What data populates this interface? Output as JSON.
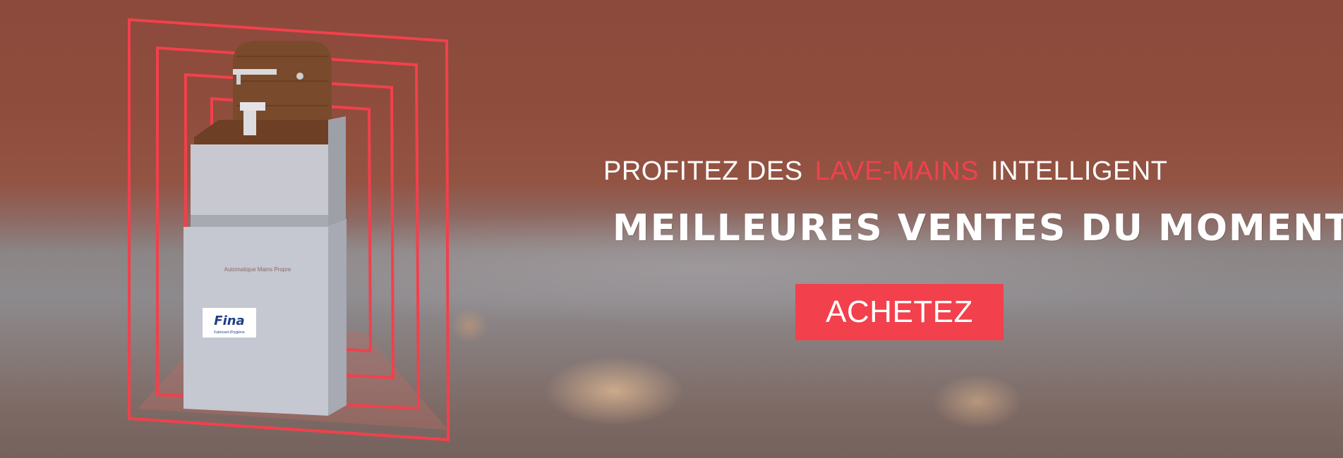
{
  "hero": {
    "headline_prefix": "PROFITEZ DES",
    "headline_accent": "LAVE-MAINS",
    "headline_suffix": "INTELLIGENT",
    "subheadline": "MEILLEURES VENTES DU MOMENT",
    "cta_label": "ACHETEZ"
  },
  "product": {
    "cabinet_label": "Automatique Mains Propre",
    "logo_text": "Fina",
    "logo_tagline": "Fabricant d'hygiène"
  },
  "colors": {
    "accent": "#f2404c",
    "headline_text": "#ffffff",
    "frame_lines": "#f2404c"
  }
}
